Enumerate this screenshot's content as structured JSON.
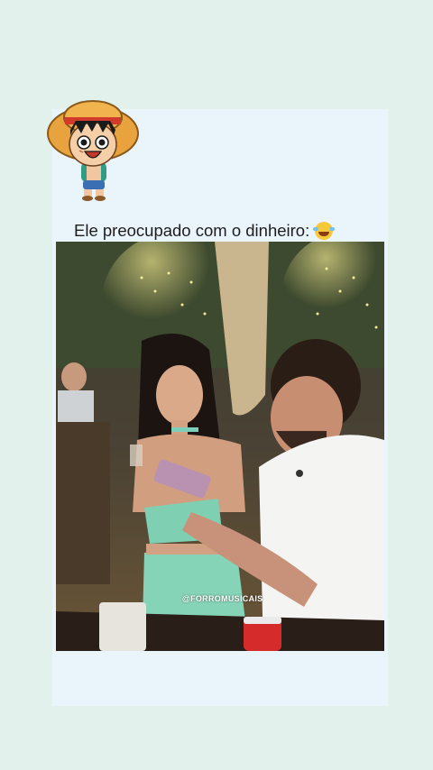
{
  "post": {
    "caption": "Ele preocupado com o dinheiro:",
    "caption_emoji": "tears-of-joy-emoji",
    "watermark": "@FORROMUSICAIS"
  },
  "colors": {
    "page_background": "#e3f1ec",
    "card_background": "#eaf4fb",
    "caption_text": "#1d1d1d"
  },
  "avatar": {
    "icon": "straw-hat-character-sticker"
  }
}
